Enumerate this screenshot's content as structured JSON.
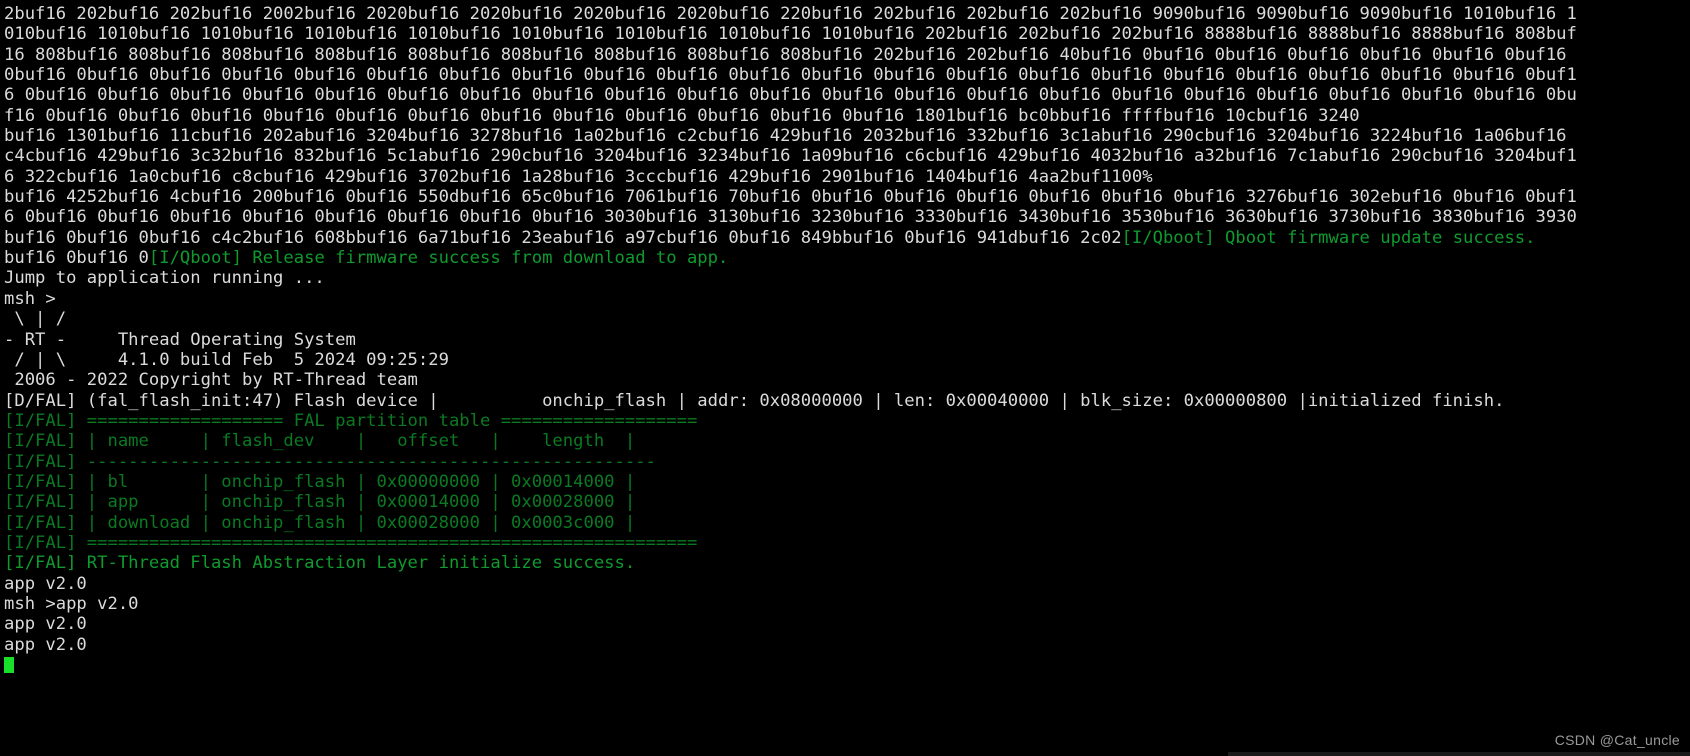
{
  "window": {
    "title": "Serial Terminal — RT-Thread Qboot Log",
    "background_color": "#000000",
    "foreground_color": "#d8d8d8",
    "green_color": "#0f9a2e",
    "dark_green_color": "#0a7a22",
    "cursor_color": "#19e028"
  },
  "watermark": {
    "text": "CSDN @Cat_uncle"
  },
  "terminal": {
    "lines": [
      {
        "id": "line-1",
        "segments": [
          {
            "color": "white",
            "text": "2buf16 202buf16 202buf16 2002buf16 2020buf16 2020buf16 2020buf16 2020buf16 220buf16 202buf16 202buf16 202buf16 9090buf16 9090buf16 9090buf16 1010buf16 1"
          }
        ]
      },
      {
        "id": "line-2",
        "segments": [
          {
            "color": "white",
            "text": "010buf16 1010buf16 1010buf16 1010buf16 1010buf16 1010buf16 1010buf16 1010buf16 1010buf16 202buf16 202buf16 202buf16 8888buf16 8888buf16 8888buf16 808buf"
          }
        ]
      },
      {
        "id": "line-3",
        "segments": [
          {
            "color": "white",
            "text": "16 808buf16 808buf16 808buf16 808buf16 808buf16 808buf16 808buf16 808buf16 808buf16 202buf16 202buf16 40buf16 0buf16 0buf16 0buf16 0buf16 0buf16 0buf16"
          }
        ]
      },
      {
        "id": "line-4",
        "segments": [
          {
            "color": "white",
            "text": "0buf16 0buf16 0buf16 0buf16 0buf16 0buf16 0buf16 0buf16 0buf16 0buf16 0buf16 0buf16 0buf16 0buf16 0buf16 0buf16 0buf16 0buf16 0buf16 0buf16 0buf16 0buf1"
          }
        ]
      },
      {
        "id": "line-5",
        "segments": [
          {
            "color": "white",
            "text": "6 0buf16 0buf16 0buf16 0buf16 0buf16 0buf16 0buf16 0buf16 0buf16 0buf16 0buf16 0buf16 0buf16 0buf16 0buf16 0buf16 0buf16 0buf16 0buf16 0buf16 0buf16 0bu"
          }
        ]
      },
      {
        "id": "line-6",
        "segments": [
          {
            "color": "white",
            "text": "f16 0buf16 0buf16 0buf16 0buf16 0buf16 0buf16 0buf16 0buf16 0buf16 0buf16 0buf16 0buf16 1801buf16 bc0bbuf16 ffffbuf16 10cbuf16 3240"
          }
        ]
      },
      {
        "id": "line-7",
        "segments": [
          {
            "color": "white",
            "text": "buf16 1301buf16 11cbuf16 202abuf16 3204buf16 3278buf16 1a02buf16 c2cbuf16 429buf16 2032buf16 332buf16 3c1abuf16 290cbuf16 3204buf16 3224buf16 1a06buf16"
          }
        ]
      },
      {
        "id": "line-8",
        "segments": [
          {
            "color": "white",
            "text": "c4cbuf16 429buf16 3c32buf16 832buf16 5c1abuf16 290cbuf16 3204buf16 3234buf16 1a09buf16 c6cbuf16 429buf16 4032buf16 a32buf16 7c1abuf16 290cbuf16 3204buf1"
          }
        ]
      },
      {
        "id": "line-9",
        "segments": [
          {
            "color": "white",
            "text": "6 322cbuf16 1a0cbuf16 c8cbuf16 429buf16 3702buf16 1a28buf16 3cccbuf16 429buf16 2901buf16 1404buf16 4aa2buf1100%"
          }
        ]
      },
      {
        "id": "line-10",
        "segments": [
          {
            "color": "white",
            "text": "buf16 4252buf16 4cbuf16 200buf16 0buf16 550dbuf16 65c0buf16 7061buf16 70buf16 0buf16 0buf16 0buf16 0buf16 0buf16 0buf16 3276buf16 302ebuf16 0buf16 0buf1"
          }
        ]
      },
      {
        "id": "line-11",
        "segments": [
          {
            "color": "white",
            "text": "6 0buf16 0buf16 0buf16 0buf16 0buf16 0buf16 0buf16 0buf16 3030buf16 3130buf16 3230buf16 3330buf16 3430buf16 3530buf16 3630buf16 3730buf16 3830buf16 3930"
          }
        ]
      },
      {
        "id": "line-12",
        "segments": [
          {
            "color": "white",
            "text": "buf16 0buf16 0buf16 c4c2buf16 608bbuf16 6a71buf16 23eabuf16 a97cbuf16 0buf16 849bbuf16 0buf16 941dbuf16 2c02"
          },
          {
            "color": "green",
            "text": "[I/Qboot] Qboot firmware update success."
          }
        ]
      },
      {
        "id": "line-13",
        "segments": [
          {
            "color": "white",
            "text": "buf16 0buf16 0"
          },
          {
            "color": "green",
            "text": "[I/Qboot] Release firmware success from download to app."
          }
        ]
      },
      {
        "id": "line-14",
        "segments": [
          {
            "color": "white",
            "text": "Jump to application running ..."
          }
        ]
      },
      {
        "id": "line-15",
        "segments": [
          {
            "color": "white",
            "text": "msh >"
          }
        ]
      },
      {
        "id": "line-16",
        "segments": [
          {
            "color": "white",
            "text": " \\ | /"
          }
        ]
      },
      {
        "id": "line-17",
        "segments": [
          {
            "color": "white",
            "text": "- RT -     Thread Operating System"
          }
        ]
      },
      {
        "id": "line-18",
        "segments": [
          {
            "color": "white",
            "text": " / | \\     4.1.0 build Feb  5 2024 09:25:29"
          }
        ]
      },
      {
        "id": "line-19",
        "segments": [
          {
            "color": "white",
            "text": " 2006 - 2022 Copyright by RT-Thread team"
          }
        ]
      },
      {
        "id": "line-20",
        "segments": [
          {
            "color": "white",
            "text": "[D/FAL] (fal_flash_init:47) Flash device |          onchip_flash | addr: 0x08000000 | len: 0x00040000 | blk_size: 0x00000800 |initialized finish."
          }
        ]
      },
      {
        "id": "line-21",
        "segments": [
          {
            "color": "dgreen",
            "text": "[I/FAL] =================== FAL partition table ==================="
          }
        ]
      },
      {
        "id": "line-22",
        "segments": [
          {
            "color": "dgreen",
            "text": "[I/FAL] | name     | flash_dev    |   offset   |    length  |"
          }
        ]
      },
      {
        "id": "line-23",
        "segments": [
          {
            "color": "dgreen",
            "text": "[I/FAL] -------------------------------------------------------"
          }
        ]
      },
      {
        "id": "line-24",
        "segments": [
          {
            "color": "dgreen",
            "text": "[I/FAL] | bl       | onchip_flash | 0x00000000 | 0x00014000 |"
          }
        ]
      },
      {
        "id": "line-25",
        "segments": [
          {
            "color": "dgreen",
            "text": "[I/FAL] | app      | onchip_flash | 0x00014000 | 0x00028000 |"
          }
        ]
      },
      {
        "id": "line-26",
        "segments": [
          {
            "color": "dgreen",
            "text": "[I/FAL] | download | onchip_flash | 0x00028000 | 0x0003c000 |"
          }
        ]
      },
      {
        "id": "line-27",
        "segments": [
          {
            "color": "dgreen",
            "text": "[I/FAL] ==========================================================="
          }
        ]
      },
      {
        "id": "line-28",
        "segments": [
          {
            "color": "green",
            "text": "[I/FAL] RT-Thread Flash Abstraction Layer initialize success."
          }
        ]
      },
      {
        "id": "line-29",
        "segments": [
          {
            "color": "white",
            "text": "app v2.0"
          }
        ]
      },
      {
        "id": "line-30",
        "segments": [
          {
            "color": "white",
            "text": "msh >app v2.0"
          }
        ]
      },
      {
        "id": "line-31",
        "segments": [
          {
            "color": "white",
            "text": "app v2.0"
          }
        ]
      },
      {
        "id": "line-32",
        "segments": [
          {
            "color": "white",
            "text": "app v2.0"
          }
        ]
      },
      {
        "id": "line-33",
        "cursor": true,
        "segments": []
      }
    ]
  }
}
